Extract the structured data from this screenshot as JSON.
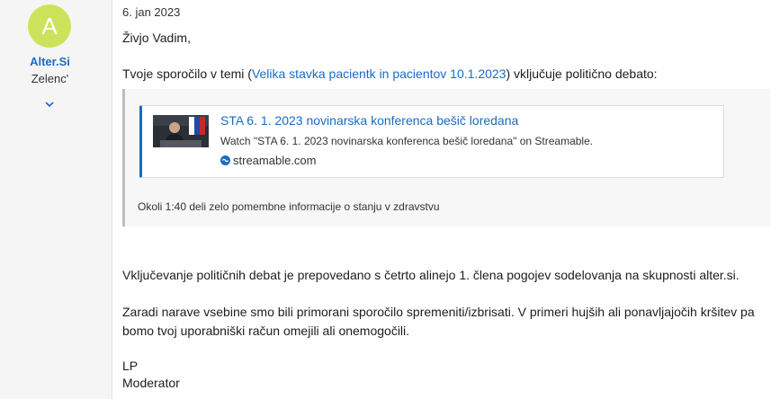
{
  "author": {
    "avatar_letter": "A",
    "avatar_color": "#cde25b",
    "name": "Alter.Si",
    "role": "Zelenc'",
    "expand_icon": "chevron-down-icon"
  },
  "post": {
    "date": "6. jan 2023",
    "greeting": "Živjo Vadim,",
    "intro_before": "Tvoje sporočilo v temi (",
    "intro_link": "Velika stavka pacientk in pacientov 10.1.2023",
    "intro_after": ") vključuje politično debato:",
    "quote": {
      "embed": {
        "title": "STA 6. 1. 2023 novinarska konferenca bešič loredana",
        "description": "Watch \"STA 6. 1. 2023 novinarska konferenca bešič loredana\" on Streamable.",
        "site": "streamable.com",
        "site_icon": "streamable-icon"
      },
      "text": "Okoli 1:40 deli zelo pomembne informacije o stanju v zdravstvu"
    },
    "rule_text": "Vključevanje političnih debat je prepovedano s četrto alinejo 1. člena pogojev sodelovanja na skupnosti alter.si.",
    "reason_line1": "Zaradi narave vsebine smo bili primorani sporočilo spremeniti/izbrisati. V primeri hujših ali ponavljajočih kršitev pa",
    "reason_line2": "bomo tvoj uporabniški račun omejili ali onemogočili.",
    "sign1": "LP",
    "sign2": "Moderator"
  },
  "colors": {
    "link": "#1a6bc4",
    "sidebar_bg": "#f5f5f5"
  }
}
